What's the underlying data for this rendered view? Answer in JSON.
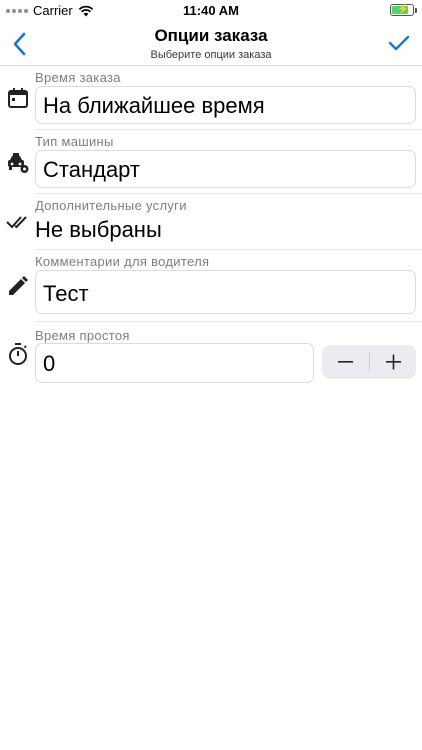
{
  "status_bar": {
    "carrier": "Carrier",
    "time": "11:40 AM"
  },
  "nav": {
    "title": "Опции заказа",
    "subtitle": "Выберите опции заказа",
    "accent": "#1a73e8"
  },
  "rows": {
    "order_time": {
      "label": "Время заказа",
      "value": "На ближайшее время",
      "icon": "calendar-icon"
    },
    "car_type": {
      "label": "Тип машины",
      "value": "Стандарт",
      "icon": "taxi-settings-icon"
    },
    "extras": {
      "label": "Дополнительные услуги",
      "value": "Не выбраны",
      "icon": "double-check-icon"
    },
    "comment": {
      "label": "Комментарии для водителя",
      "value": "Тест",
      "icon": "pencil-icon"
    },
    "idle_time": {
      "label": "Время простоя",
      "value": "0",
      "icon": "timer-icon",
      "stepper_minus": "−",
      "stepper_plus": "+"
    }
  }
}
